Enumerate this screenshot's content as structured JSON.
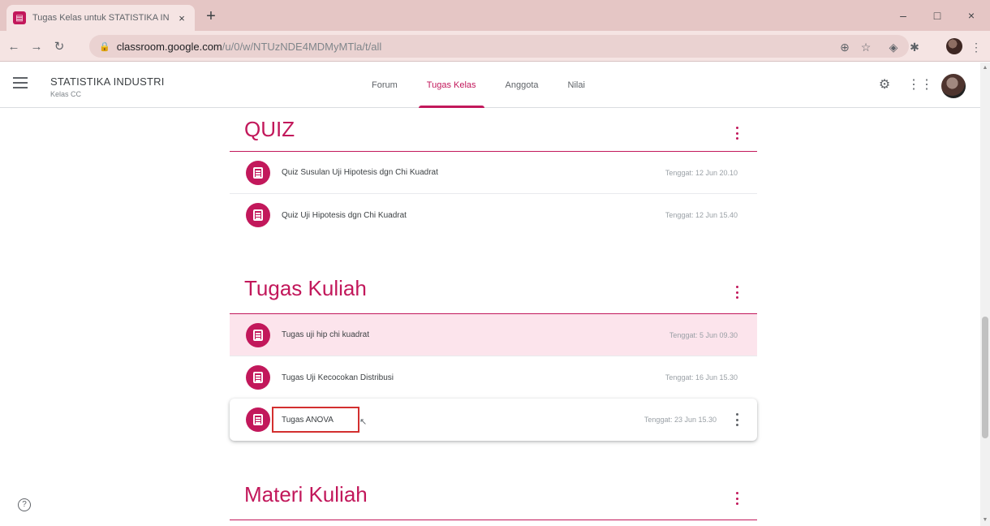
{
  "browser": {
    "tab_title": "Tugas Kelas untuk STATISTIKA IN",
    "tab_close": "×",
    "new_tab": "+",
    "url_host": "classroom.google.com",
    "url_path": "/u/0/w/NTUzNDE4MDMyMTla/t/all",
    "win_min": "–",
    "win_max": "□",
    "win_close": "×"
  },
  "header": {
    "class_name": "STATISTIKA INDUSTRI",
    "class_section": "Kelas CC",
    "tabs": [
      {
        "label": "Forum"
      },
      {
        "label": "Tugas Kelas"
      },
      {
        "label": "Anggota"
      },
      {
        "label": "Nilai"
      }
    ],
    "active_tab": "Tugas Kelas"
  },
  "topics": [
    {
      "title": "QUIZ",
      "items": [
        {
          "title": "Quiz Susulan Uji Hipotesis dgn Chi Kuadrat",
          "due": "Tenggat: 12 Jun 20.10"
        },
        {
          "title": "Quiz Uji Hipotesis dgn Chi Kuadrat",
          "due": "Tenggat: 12 Jun 15.40"
        }
      ]
    },
    {
      "title": "Tugas Kuliah",
      "items": [
        {
          "title": "Tugas uji hip chi kuadrat",
          "due": "Tenggat: 5 Jun 09.30"
        },
        {
          "title": "Tugas Uji Kecocokan Distribusi",
          "due": "Tenggat: 16 Jun 15.30"
        },
        {
          "title": "Tugas ANOVA",
          "due": "Tenggat: 23 Jun 15.30"
        }
      ]
    },
    {
      "title": "Materi Kuliah",
      "items": []
    }
  ],
  "colors": {
    "accent": "#c2185b",
    "highlight_row": "#fce4ec",
    "annotation_box": "#d32f2f"
  },
  "help": "?"
}
